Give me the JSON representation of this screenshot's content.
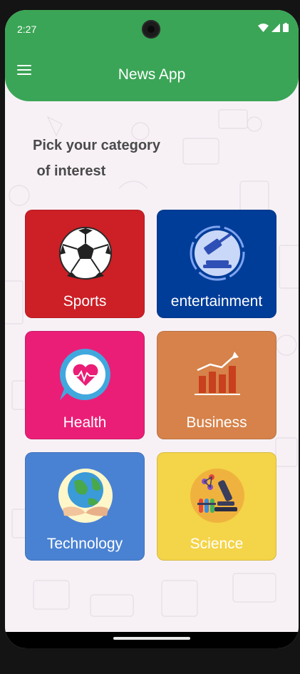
{
  "status_bar": {
    "time": "2:27"
  },
  "app_bar": {
    "title": "News App",
    "menu_icon": "hamburger-menu-icon"
  },
  "heading": "Pick your category\n of interest",
  "categories": [
    {
      "label": "Sports",
      "icon": "soccer-ball-icon",
      "color": "#cc1f26"
    },
    {
      "label": "entertainment",
      "icon": "gavel-icon",
      "color": "#003d99"
    },
    {
      "label": "Health",
      "icon": "heart-pulse-icon",
      "color": "#ea1e77"
    },
    {
      "label": "Business",
      "icon": "bar-chart-growth-icon",
      "color": "#d6824a"
    },
    {
      "label": "Technology",
      "icon": "earth-hands-icon",
      "color": "#4a82d3"
    },
    {
      "label": "Science",
      "icon": "microscope-lab-icon",
      "color": "#f4d448"
    }
  ],
  "colors": {
    "app_bar": "#3aa556",
    "background": "#f7f1f6"
  }
}
